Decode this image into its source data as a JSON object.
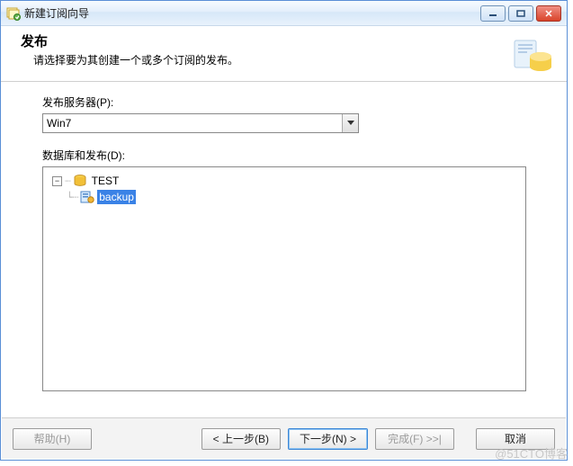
{
  "title": "新建订阅向导",
  "header": {
    "title": "发布",
    "subtitle": "请选择要为其创建一个或多个订阅的发布。"
  },
  "server_field": {
    "label": "发布服务器(P):",
    "value": "Win7"
  },
  "db_field": {
    "label": "数据库和发布(D):"
  },
  "tree": {
    "root": "TEST",
    "child": "backup"
  },
  "footer": {
    "help": "帮助(H)",
    "back": "< 上一步(B)",
    "next": "下一步(N) >",
    "finish": "完成(F) >>|",
    "cancel": "取消"
  },
  "watermark": "@51CTO博客"
}
